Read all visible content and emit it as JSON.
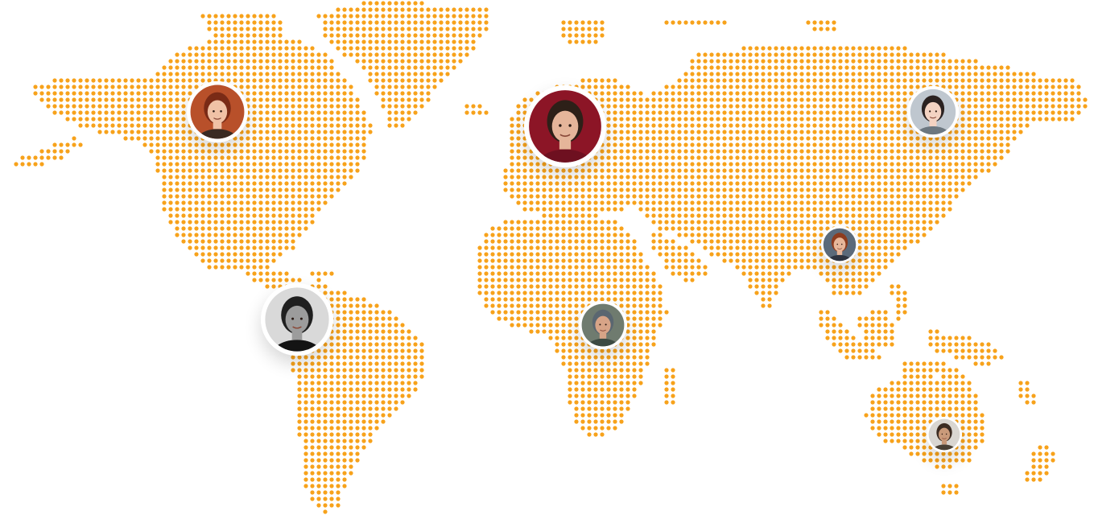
{
  "map": {
    "dot_color": "#F7A21B",
    "background": "#FFFFFF",
    "avatar_ring": "#FFFFFF"
  },
  "avatars": [
    {
      "id": "north-america",
      "skin": "#f0c2a6",
      "hair": "#7a2b16",
      "bg": "#b8502a",
      "shirt": "#3a2a22"
    },
    {
      "id": "south-america",
      "skin": "#9c9c9c",
      "hair": "#1f1f1f",
      "bg": "#d9d9d9",
      "shirt": "#141414"
    },
    {
      "id": "europe",
      "skin": "#e5b59a",
      "hair": "#2d2018",
      "bg": "#8c1526",
      "shirt": "#6e1020"
    },
    {
      "id": "africa",
      "skin": "#d7a487",
      "hair": "#5a6670",
      "bg": "#6f7b6f",
      "shirt": "#3c4a42"
    },
    {
      "id": "east-asia",
      "skin": "#f4d3c2",
      "hair": "#2b2221",
      "bg": "#bfc7cf",
      "shirt": "#6c7780"
    },
    {
      "id": "south-asia",
      "skin": "#e8b79a",
      "hair": "#8e3c1e",
      "bg": "#5b6a7a",
      "shirt": "#2e3440"
    },
    {
      "id": "australia",
      "skin": "#c99a7a",
      "hair": "#3c2c22",
      "bg": "#d9d6d1",
      "shirt": "#494035"
    }
  ]
}
